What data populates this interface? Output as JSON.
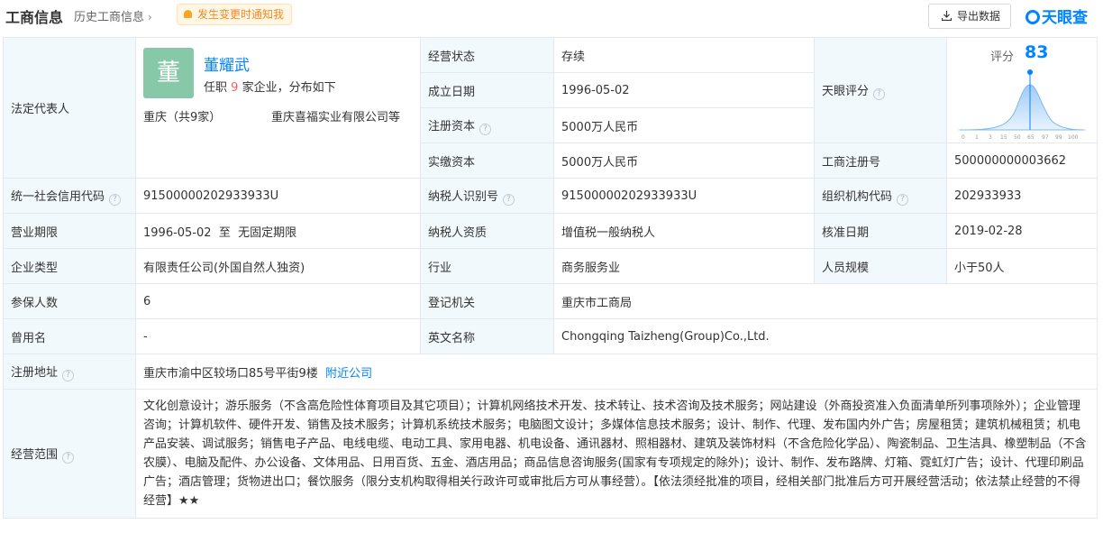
{
  "header": {
    "title": "工商信息",
    "history_label": "历史工商信息",
    "notify_label": "发生变更时通知我",
    "export_label": "导出数据",
    "logo_text": "天眼查"
  },
  "legal_rep": {
    "label": "法定代表人",
    "avatar_char": "董",
    "name": "董耀武",
    "count_prefix": "任职",
    "count": "9",
    "count_suffix": "家企业，分布如下",
    "city": "重庆（共9家）",
    "company": "重庆喜福实业有限公司等"
  },
  "rows": {
    "status_label": "经营状态",
    "status_value": "存续",
    "founded_label": "成立日期",
    "founded_value": "1996-05-02",
    "reg_capital_label": "注册资本",
    "reg_capital_value": "5000万人民币",
    "paid_capital_label": "实缴资本",
    "paid_capital_value": "5000万人民币",
    "score_label": "天眼评分",
    "reg_no_label": "工商注册号",
    "reg_no_value": "500000000003662",
    "credit_code_label": "统一社会信用代码",
    "credit_code_value": "91500000202933933U",
    "taxpayer_id_label": "纳税人识别号",
    "taxpayer_id_value": "91500000202933933U",
    "org_code_label": "组织机构代码",
    "org_code_value": "202933933",
    "term_label": "营业期限",
    "term_value": "1996-05-02  至  无固定期限",
    "taxpayer_qual_label": "纳税人资质",
    "taxpayer_qual_value": "增值税一般纳税人",
    "approve_label": "核准日期",
    "approve_value": "2019-02-28",
    "type_label": "企业类型",
    "type_value": "有限责任公司(外国自然人独资)",
    "industry_label": "行业",
    "industry_value": "商务服务业",
    "staff_label": "人员规模",
    "staff_value": "小于50人",
    "insured_label": "参保人数",
    "insured_value": "6",
    "authority_label": "登记机关",
    "authority_value": "重庆市工商局",
    "former_label": "曾用名",
    "former_value": "-",
    "en_name_label": "英文名称",
    "en_name_value": "Chongqing Taizheng(Group)Co.,Ltd.",
    "address_label": "注册地址",
    "address_value": "重庆市渝中区较场口85号平街9楼",
    "nearby_label": "附近公司",
    "scope_label": "经营范围",
    "scope_value": "文化创意设计；游乐服务（不含高危险性体育项目及其它项目）；计算机网络技术开发、技术转让、技术咨询及技术服务；网站建设（外商投资准入负面清单所列事项除外）；企业管理咨询；计算机软件、硬件开发、销售及技术服务；计算机系统技术服务；电脑图文设计；多媒体信息技术服务；设计、制作、代理、发布国内外广告；房屋租赁；建筑机械租赁；机电产品安装、调试服务；销售电子产品、电线电缆、电动工具、家用电器、机电设备、通讯器材、照相器材、建筑及装饰材料（不含危险化学品）、陶瓷制品、卫生洁具、橡塑制品（不含农膜）、电脑及配件、办公设备、文体用品、日用百货、五金、酒店用品；商品信息咨询服务(国家有专项规定的除外)；设计、制作、发布路牌、灯箱、霓虹灯广告；设计、代理印刷品广告；酒店管理；货物进出口；餐饮服务（限分支机构取得相关行政许可或审批后方可从事经营）。【依法须经批准的项目，经相关部门批准后方可开展经营活动；依法禁止经营的不得经营】★★"
  },
  "score": {
    "label": "评分",
    "value": "83",
    "ticks": [
      "0",
      "1",
      "3",
      "15",
      "50",
      "65",
      "97",
      "99",
      "100"
    ],
    "accent": "#0084ff"
  }
}
